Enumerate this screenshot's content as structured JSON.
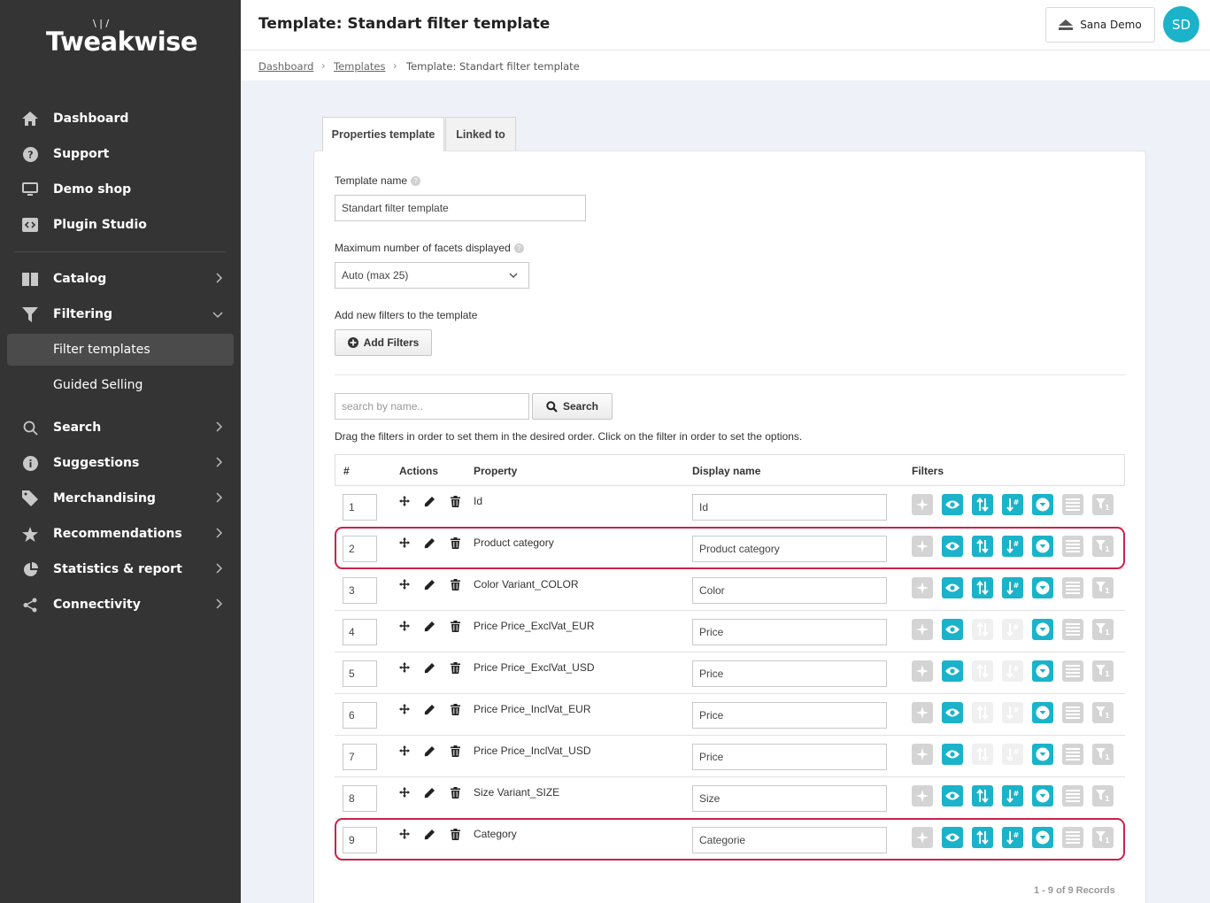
{
  "brand": {
    "logo_text": "Tweakwise",
    "accent": "#1ab3c9",
    "sidebar_bg": "#343434",
    "highlight": "#c8244a"
  },
  "sidebar": {
    "items": [
      {
        "label": "Dashboard",
        "icon": "home-icon"
      },
      {
        "label": "Support",
        "icon": "question-circle-icon"
      },
      {
        "label": "Demo shop",
        "icon": "monitor-icon"
      },
      {
        "label": "Plugin Studio",
        "icon": "code-icon"
      },
      {
        "label": "Catalog",
        "icon": "book-icon"
      },
      {
        "label": "Filtering",
        "icon": "funnel-icon",
        "expanded": true
      },
      {
        "label": "Search",
        "icon": "search-icon"
      },
      {
        "label": "Suggestions",
        "icon": "info-icon"
      },
      {
        "label": "Merchandising",
        "icon": "tag-icon"
      },
      {
        "label": "Recommendations",
        "icon": "star-icon"
      },
      {
        "label": "Statistics & report",
        "icon": "pie-chart-icon"
      },
      {
        "label": "Connectivity",
        "icon": "share-icon"
      }
    ],
    "sub_items": [
      {
        "label": "Filter templates",
        "active": true
      },
      {
        "label": "Guided Selling",
        "active": false
      }
    ]
  },
  "header": {
    "title": "Template: Standart filter template",
    "shop_label": "Sana Demo",
    "avatar_initials": "SD"
  },
  "breadcrumb": [
    "Dashboard",
    "Templates",
    "Template: Standart filter template"
  ],
  "tabs": [
    {
      "label": "Properties template",
      "active": true
    },
    {
      "label": "Linked to",
      "active": false
    }
  ],
  "form": {
    "template_name_label": "Template name",
    "template_name_value": "Standart filter template",
    "max_facets_label": "Maximum number of facets displayed",
    "max_facets_value": "Auto (max 25)",
    "add_filters_label": "Add new filters to the template",
    "add_filters_button": "Add Filters",
    "search_placeholder": "search by name..",
    "search_button": "Search",
    "hint": "Drag the filters in order to set them in the desired order. Click on the filter in order to set the options."
  },
  "table": {
    "headers": [
      "#",
      "Actions",
      "Property",
      "Display name",
      "Filters"
    ],
    "rows": [
      {
        "pos": "1",
        "property": "Id",
        "display": "Id",
        "sort": true,
        "highlight": false
      },
      {
        "pos": "2",
        "property": "Product category",
        "display": "Product category",
        "sort": true,
        "highlight": true
      },
      {
        "pos": "3",
        "property": "Color Variant_COLOR",
        "display": "Color",
        "sort": true,
        "highlight": false
      },
      {
        "pos": "4",
        "property": "Price Price_ExclVat_EUR",
        "display": "Price",
        "sort": false,
        "highlight": false
      },
      {
        "pos": "5",
        "property": "Price Price_ExclVat_USD",
        "display": "Price",
        "sort": false,
        "highlight": false
      },
      {
        "pos": "6",
        "property": "Price Price_InclVat_EUR",
        "display": "Price",
        "sort": false,
        "highlight": false
      },
      {
        "pos": "7",
        "property": "Price Price_InclVat_USD",
        "display": "Price",
        "sort": false,
        "highlight": false
      },
      {
        "pos": "8",
        "property": "Size Variant_SIZE",
        "display": "Size",
        "sort": true,
        "highlight": false
      },
      {
        "pos": "9",
        "property": "Category",
        "display": "Categorie",
        "sort": true,
        "highlight": true
      }
    ],
    "records": "1 - 9 of 9 Records"
  }
}
